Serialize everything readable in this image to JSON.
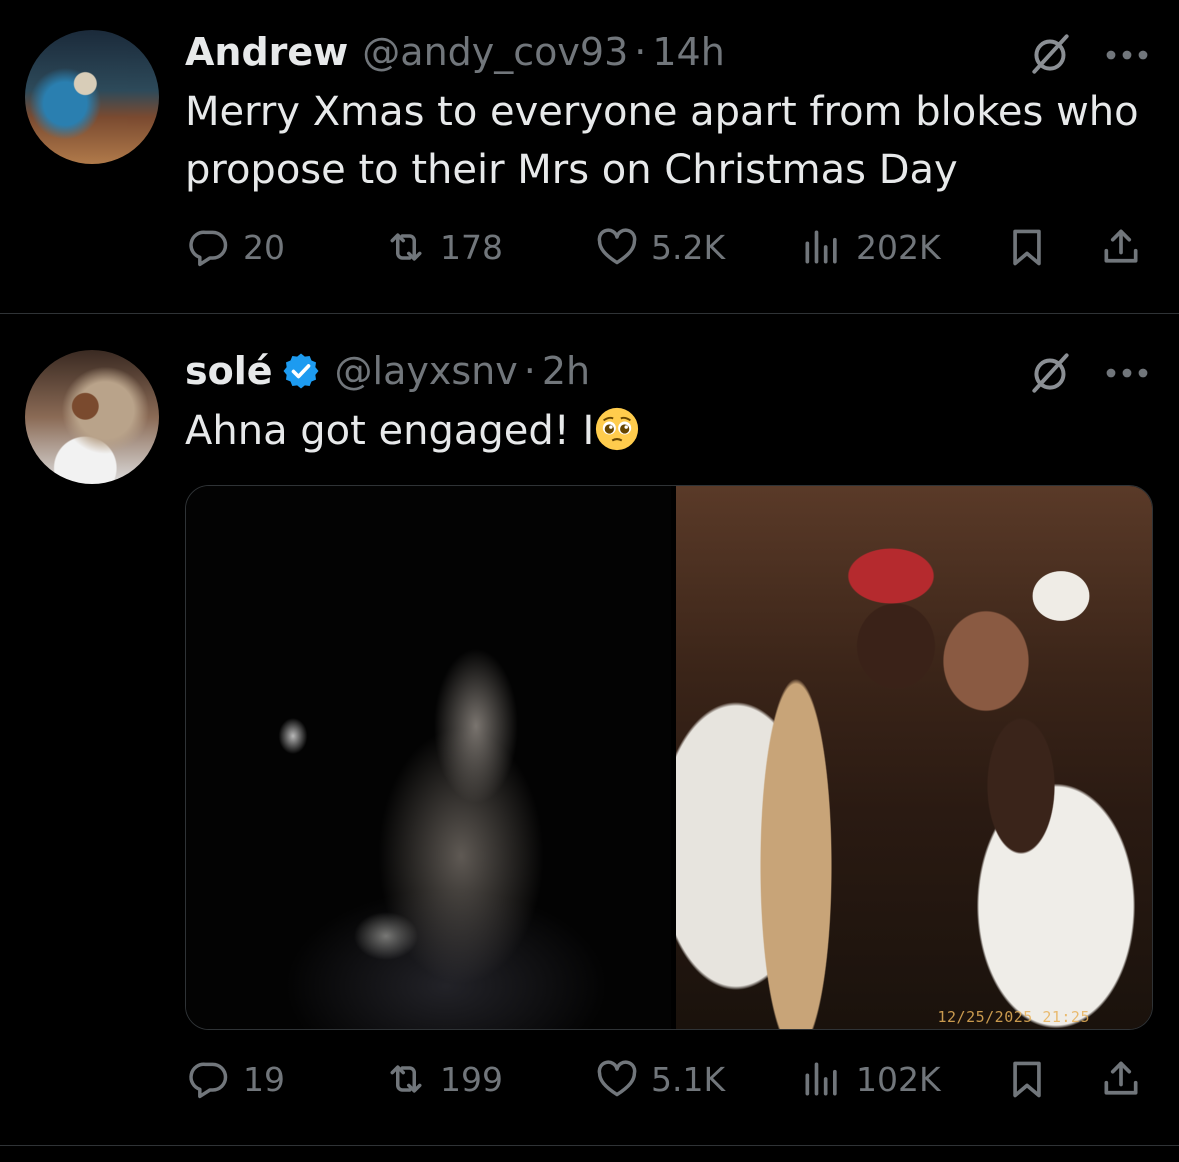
{
  "tweets": [
    {
      "name": "Andrew",
      "handle": "@andy_cov93",
      "separator": "·",
      "time": "14h",
      "verified": false,
      "text_lines": [
        "Merry Xmas to everyone apart from blokes who",
        "propose to their Mrs on Christmas Day"
      ],
      "stats": {
        "replies": "20",
        "reposts": "178",
        "likes": "5.2K",
        "views": "202K"
      }
    },
    {
      "name": "solé",
      "handle": "@layxsnv",
      "separator": "·",
      "time": "2h",
      "verified": true,
      "text": "Ahna got engaged! I",
      "emoji": "pleading-face",
      "photo_timestamp": "12/25/2025 21:25",
      "stats": {
        "replies": "19",
        "reposts": "199",
        "likes": "5.1K",
        "views": "102K"
      }
    }
  ],
  "colors": {
    "background": "#000000",
    "text": "#e7e9ea",
    "muted": "#71767b",
    "verified": "#1d9bf0",
    "divider": "#2f3336"
  }
}
